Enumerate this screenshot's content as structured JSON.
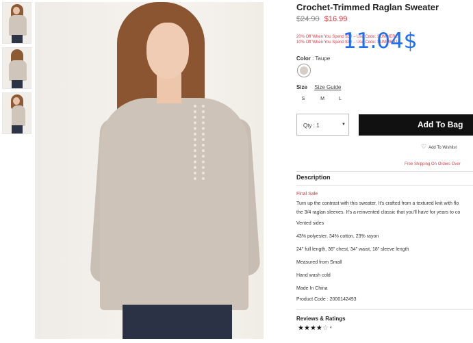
{
  "thumbnails": [
    {
      "label": "front-view"
    },
    {
      "label": "back-view"
    },
    {
      "label": "side-view"
    }
  ],
  "product": {
    "title": "Crochet-Trimmed Raglan Sweater",
    "old_price": "$24.90",
    "new_price": "$16.99",
    "promo_line1": "20% Off When You Spend $50 – Use Code: SUMMER20",
    "promo_line2": "10% Off When You Spend $30 – Use Code: SUMMER10",
    "overlay_price": "11.04$",
    "color_label": "Color",
    "color_value": ": Taupe",
    "size_label": "Size",
    "size_guide": "Size Guide",
    "sizes": [
      "S",
      "M",
      "L"
    ],
    "qty_label": "Qty : 1",
    "add_to_bag": "Add To Bag",
    "wishlist": "Add To Wishlist",
    "free_shipping": "Free Shipping On Orders Over"
  },
  "description": {
    "title": "Description",
    "final_sale": "Final Sale",
    "line1": "Turn up the contrast with this sweater. It's crafted from a textured knit with flo",
    "line2": "the 3/4 raglan sleeves. It's a reinvented classic that you'll have for years to co",
    "items": [
      "Vented sides",
      "43% polyester, 34% cotton, 23% rayon",
      "24\" full length, 36\" chest, 34\" waist, 18\" sleeve length",
      "Measured from Small",
      "Hand wash cold",
      "Made In China",
      "Product Code : 2000142493"
    ]
  },
  "reviews": {
    "title": "Reviews & Ratings",
    "rating": 4,
    "max": 5,
    "count": "4"
  },
  "colors": {
    "sale_red": "#d9343c",
    "overlay_blue": "#1e6ff0",
    "button_black": "#111111"
  }
}
